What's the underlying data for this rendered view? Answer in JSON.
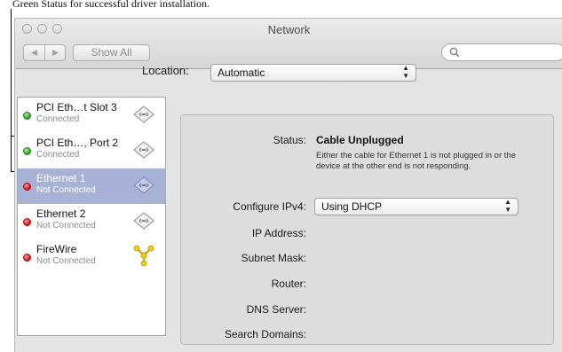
{
  "annotation": {
    "caption": "Green Status for successful driver installation."
  },
  "window": {
    "title": "Network",
    "show_all_label": "Show All",
    "search_placeholder": ""
  },
  "location": {
    "label": "Location:",
    "value": "Automatic"
  },
  "services": [
    {
      "name": "PCI Eth…t Slot 3",
      "status": "Connected",
      "status_color": "green",
      "icon": "ethernet-icon",
      "selected": false
    },
    {
      "name": "PCI Eth…, Port 2",
      "status": "Connected",
      "status_color": "green",
      "icon": "ethernet-icon",
      "selected": false
    },
    {
      "name": "Ethernet 1",
      "status": "Not Connected",
      "status_color": "red",
      "icon": "ethernet-icon",
      "selected": true
    },
    {
      "name": "Ethernet 2",
      "status": "Not Connected",
      "status_color": "red",
      "icon": "ethernet-icon",
      "selected": false
    },
    {
      "name": "FireWire",
      "status": "Not Connected",
      "status_color": "red",
      "icon": "firewire-icon",
      "selected": false
    }
  ],
  "detail": {
    "status_label": "Status:",
    "status_value": "Cable Unplugged",
    "status_description": "Either the cable for Ethernet 1 is not plugged in or the device at the other end is not responding.",
    "configure_label": "Configure IPv4:",
    "configure_value": "Using DHCP",
    "ip_label": "IP Address:",
    "subnet_label": "Subnet Mask:",
    "router_label": "Router:",
    "dns_label": "DNS Server:",
    "search_domains_label": "Search Domains:"
  },
  "colors": {
    "selection": "#a7b2d6",
    "status_green": "#2c9e1f",
    "status_red": "#d0141a",
    "firewire_yellow": "#e8d21a"
  }
}
